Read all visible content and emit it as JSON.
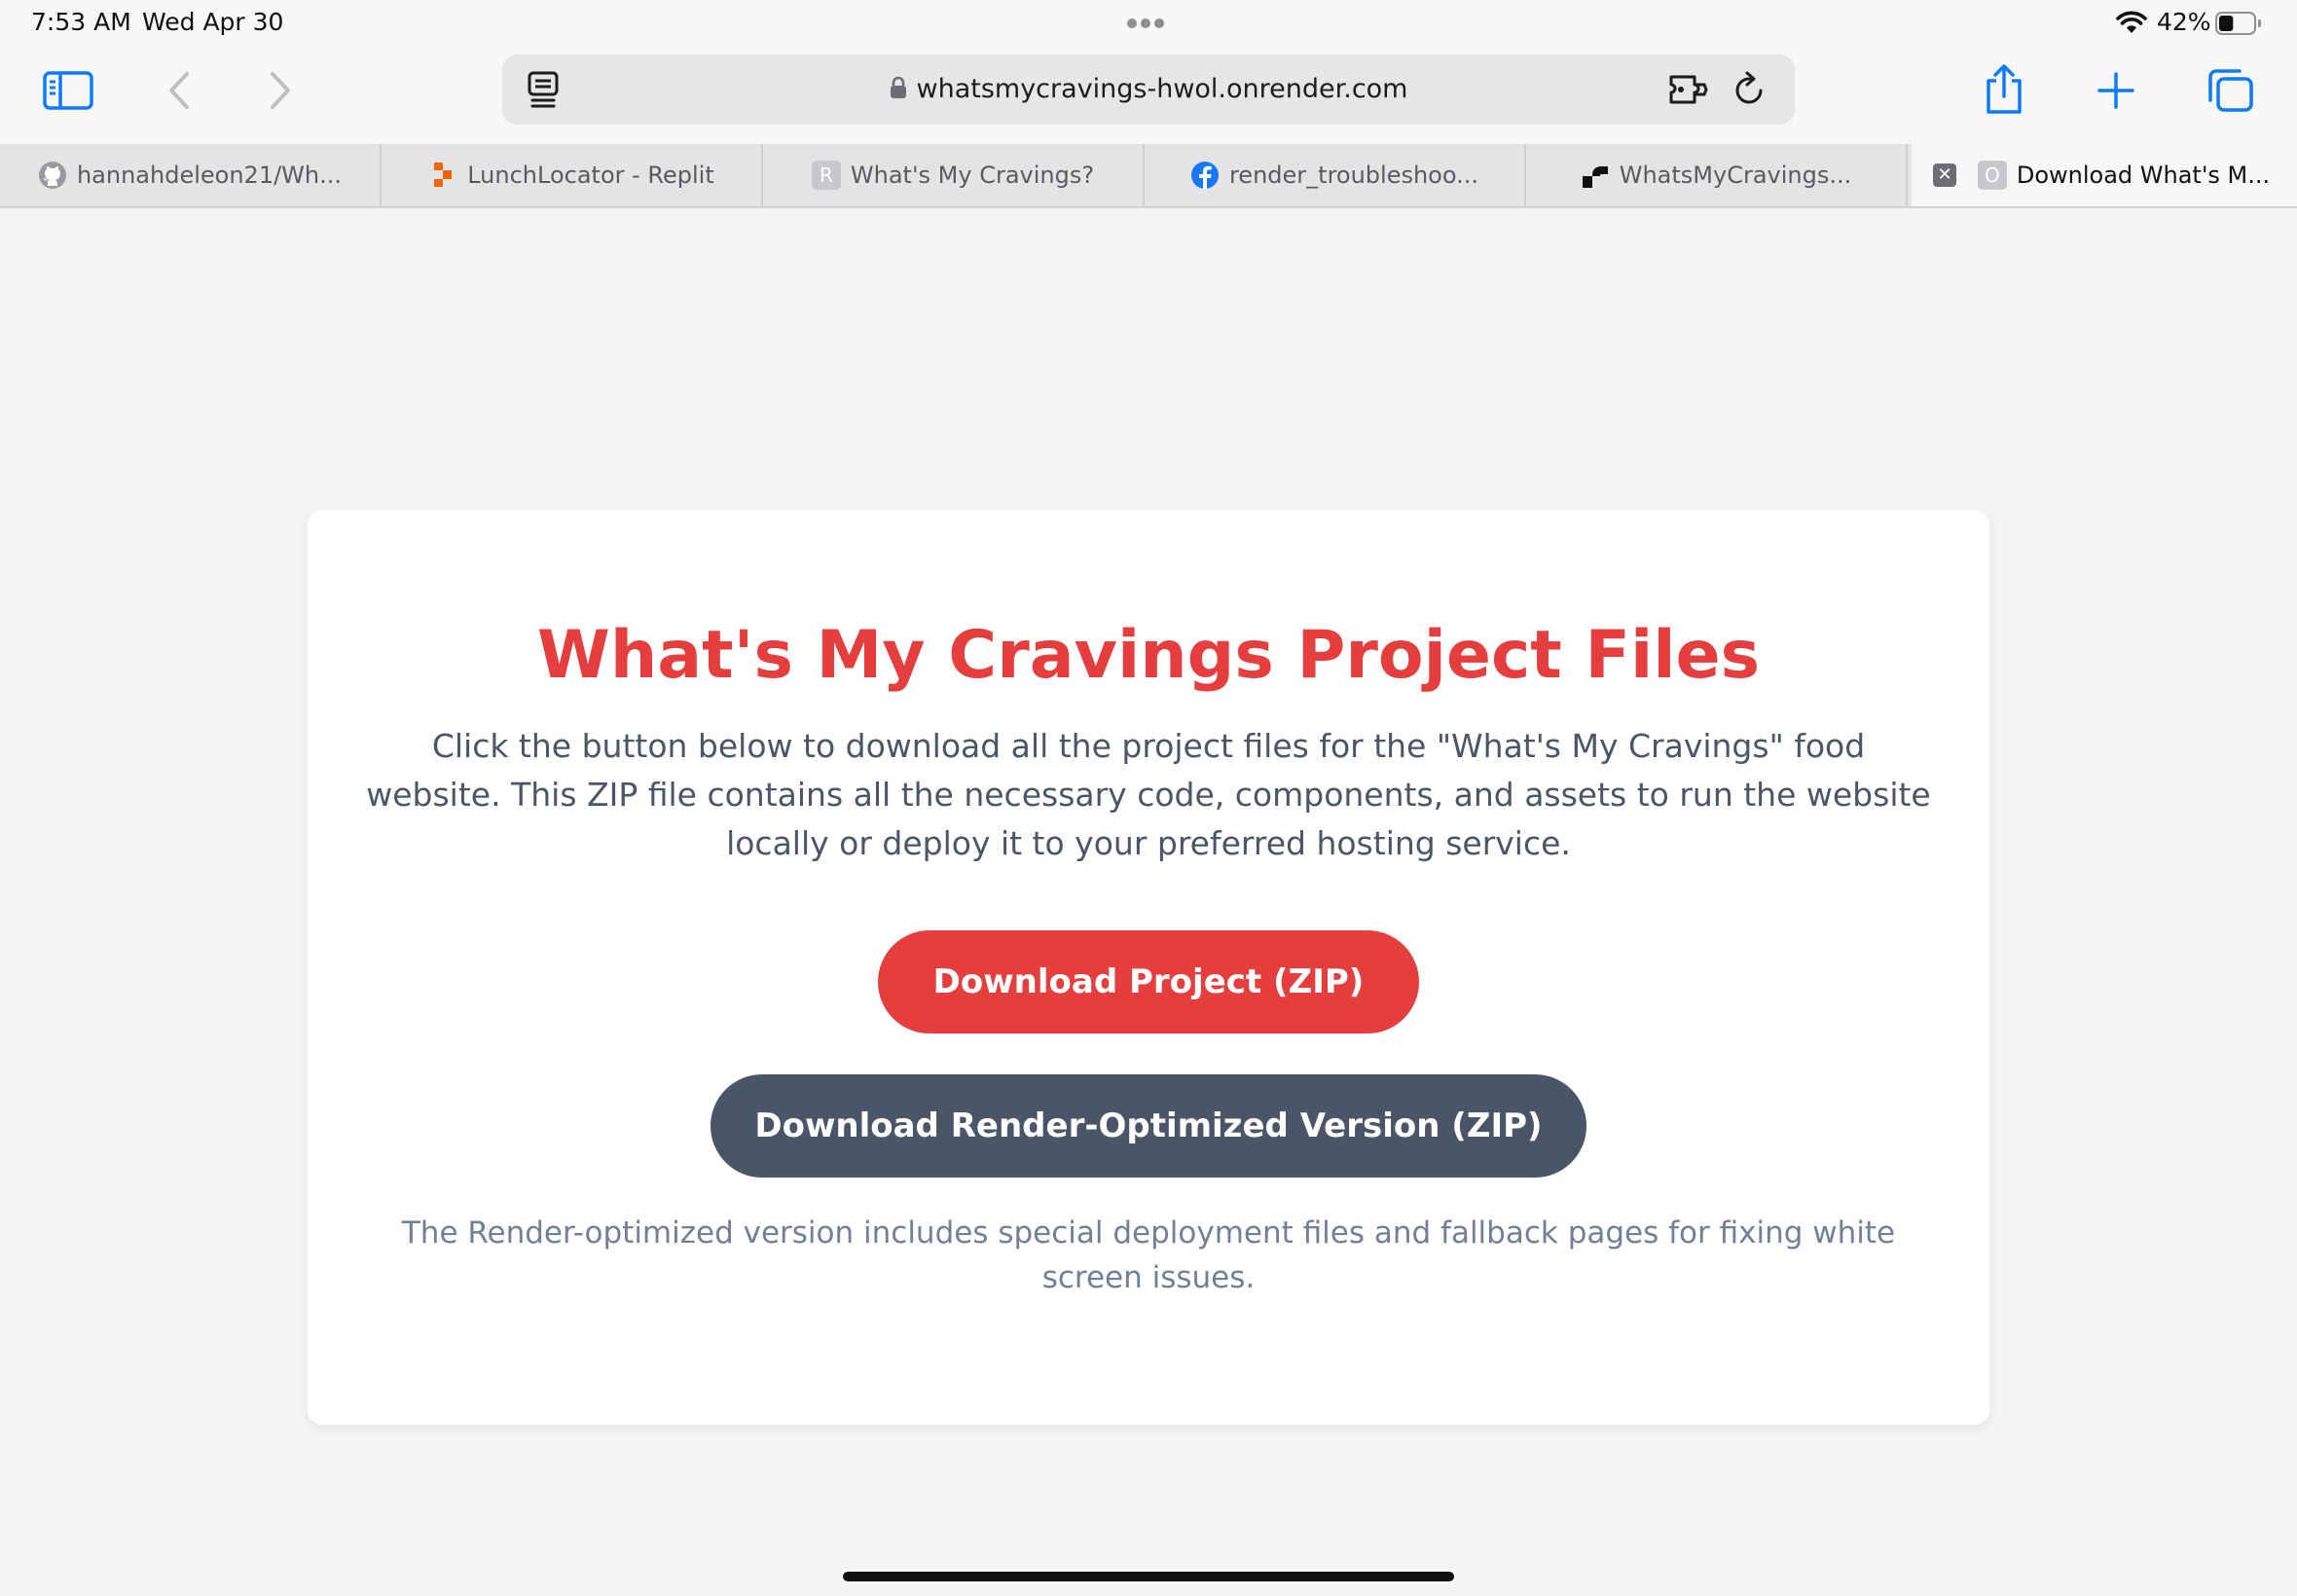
{
  "status_bar": {
    "time": "7:53 AM",
    "date": "Wed Apr 30",
    "battery_percent": "42%",
    "battery_level": 0.42
  },
  "toolbar": {
    "url": "whatsmycravings-hwol.onrender.com",
    "icons": [
      "sidebar-icon",
      "back-icon",
      "forward-icon",
      "reader-icon",
      "lock-icon",
      "extensions-icon",
      "reload-icon",
      "share-icon",
      "new-tab-icon",
      "tabs-overview-icon"
    ]
  },
  "tabs": [
    {
      "label": "hannahdeleon21/Wh...",
      "favicon": "github-icon"
    },
    {
      "label": "LunchLocator - Replit",
      "favicon": "replit-icon"
    },
    {
      "label": "What's My Cravings?",
      "favicon": "letter-r-icon"
    },
    {
      "label": "render_troubleshoo...",
      "favicon": "facebook-icon"
    },
    {
      "label": "WhatsMyCravings...",
      "favicon": "render-icon"
    },
    {
      "label": "Download What's M...",
      "favicon": "letter-o-icon",
      "active": true
    }
  ],
  "tab_favicon_letters": {
    "r": "R",
    "o": "O"
  },
  "page": {
    "title": "What's My Cravings Project Files",
    "description": "Click the button below to download all the project files for the \"What's My Cravings\" food website. This ZIP file contains all the necessary code, components, and assets to run the website locally or deploy it to your preferred hosting service.",
    "primary_button": "Download Project (ZIP)",
    "secondary_button": "Download Render-Optimized Version (ZIP)",
    "note": "The Render-optimized version includes special deployment files and fallback pages for fixing white screen issues."
  },
  "colors": {
    "accent_red": "#e53e3e",
    "slate": "#4a5568",
    "text_gray": "#718096",
    "safari_blue": "#0a7aff"
  }
}
